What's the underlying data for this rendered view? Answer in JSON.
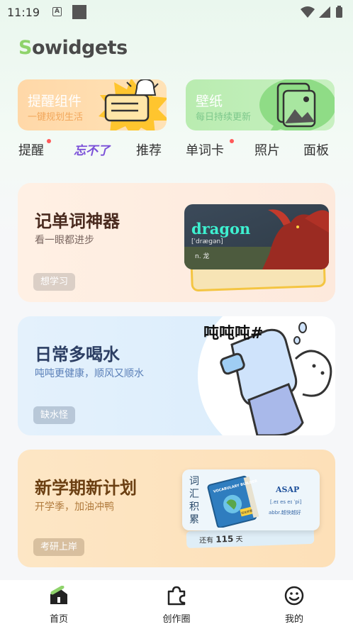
{
  "status_bar": {
    "time": "11:19",
    "a_badge": "A"
  },
  "app": {
    "logo_text_s": "S",
    "logo_text_rest": "owidgets"
  },
  "top_cards": {
    "remind": {
      "title": "提醒组件",
      "subtitle": "一键规划生活"
    },
    "wallpaper": {
      "title": "壁纸",
      "subtitle": "每日持续更新"
    }
  },
  "categories": [
    {
      "label": "提醒",
      "dot": true
    },
    {
      "label": "忘不了",
      "dot": false
    },
    {
      "label": "推荐",
      "dot": false
    },
    {
      "label": "单词卡",
      "dot": true
    },
    {
      "label": "照片",
      "dot": false
    },
    {
      "label": "面板",
      "dot": false
    }
  ],
  "features": [
    {
      "title": "记单词神器",
      "subtitle": "看一眼都进步",
      "tag": "想学习",
      "card": {
        "word": "dragon",
        "ipa": "[ˈdræɡən]",
        "meaning": "n. 龙"
      }
    },
    {
      "title": "日常多喝水",
      "subtitle": "吨吨更健康，顺风又顺水",
      "tag": "缺水怪",
      "art_text": "吨吨吨#"
    },
    {
      "title": "新学期新计划",
      "subtitle": "开学季，加油冲鸭",
      "tag": "考研上岸",
      "card": {
        "label": "词汇积累",
        "book_title": "VOCABULARY BUILDER",
        "book_badge": "轻松积累",
        "word": "ASAP",
        "ipa": "[.eɪ es eɪ ˈpi]",
        "meaning": "abbr.越快越好",
        "days_prefix": "还有",
        "days_count": "115",
        "days_suffix": "天"
      }
    }
  ],
  "bottom_nav": [
    {
      "label": "首页",
      "icon": "home-icon",
      "active": true
    },
    {
      "label": "创作圈",
      "icon": "puzzle-icon",
      "active": false
    },
    {
      "label": "我的",
      "icon": "smiley-icon",
      "active": false
    }
  ],
  "colors": {
    "accent_green": "#8fd36b",
    "remind_card": "#ffd8a8",
    "wallpaper_card": "#b9ecb0",
    "notify_dot": "#ff5a5a"
  }
}
